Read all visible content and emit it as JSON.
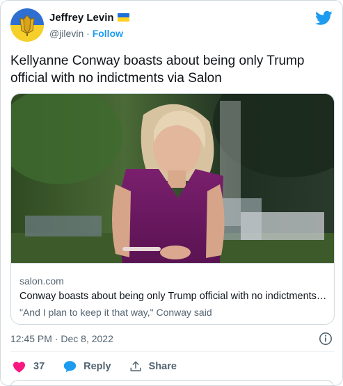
{
  "author": {
    "name": "Jeffrey Levin",
    "handle": "@jilevin",
    "separator": "·",
    "follow_label": "Follow"
  },
  "tweet": {
    "text": "Kellyanne Conway boasts about being only Trump official with no indictments via Salon"
  },
  "card": {
    "domain": "salon.com",
    "title": "Conway boasts about being only Trump official with no indictments via Salon",
    "description": "\"And I plan to keep it that way,\" Conway said"
  },
  "timestamp": "12:45 PM · Dec 8, 2022",
  "actions": {
    "like_count": "37",
    "reply_label": "Reply",
    "share_label": "Share"
  },
  "colors": {
    "accent": "#1d9bf0",
    "like": "#f91880",
    "secondary_text": "#536471",
    "border": "#cfd9de"
  },
  "icons": [
    "avatar-crest",
    "ukraine-flag-icon",
    "twitter-bird-icon",
    "info-icon",
    "heart-icon",
    "reply-bubble-icon",
    "share-icon"
  ]
}
